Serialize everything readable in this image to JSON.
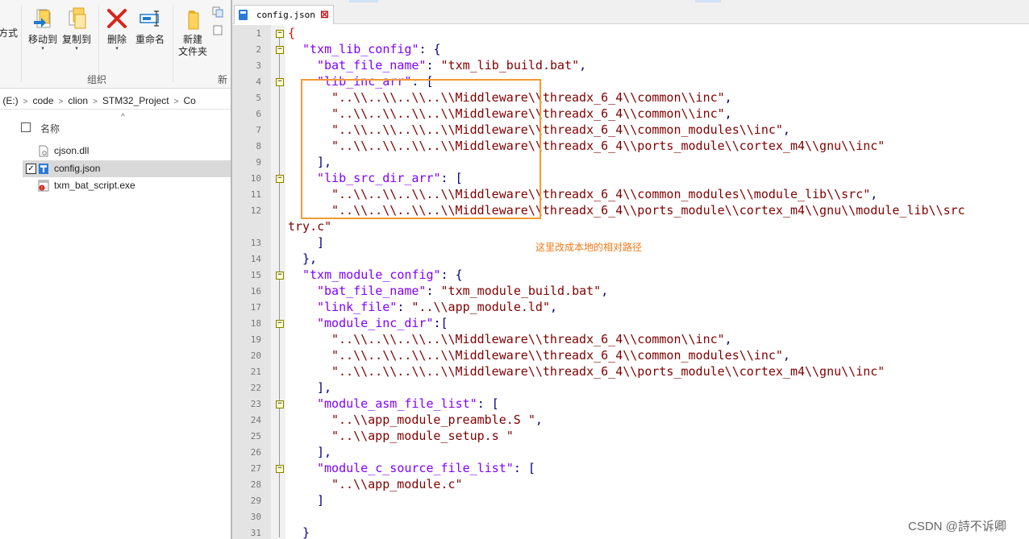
{
  "explorer": {
    "ribbon": {
      "cut_label": "方式",
      "move_to": "移动到",
      "copy_to": "复制到",
      "delete": "删除",
      "rename": "重命名",
      "new_folder_line1": "新建",
      "new_folder_line2": "文件夹",
      "group_organize": "组织",
      "group_new": "新",
      "icon_names": [
        "move-to-icon",
        "copy-to-icon",
        "delete-icon",
        "rename-icon",
        "new-folder-icon"
      ]
    },
    "breadcrumb": [
      "盘 (E:)",
      "code",
      "clion",
      "STM32_Project",
      "Co"
    ],
    "column_name": "名称",
    "files": [
      {
        "name": "cjson.dll",
        "icon": "dll-file-icon",
        "checked": false,
        "selected": false
      },
      {
        "name": "config.json",
        "icon": "json-file-icon",
        "checked": true,
        "selected": true
      },
      {
        "name": "txm_bat_script.exe",
        "icon": "exe-file-icon",
        "checked": false,
        "selected": false
      }
    ]
  },
  "editor": {
    "tab_label": "config.json",
    "tab_close": "⊠",
    "colors": {
      "keyword": "#8000ff",
      "string": "#800000",
      "punct": "#000080",
      "gutter": "#e4e4e4",
      "box": "#f39a36"
    },
    "line_numbers": [
      "1",
      "2",
      "3",
      "4",
      "5",
      "6",
      "7",
      "8",
      "9",
      "10",
      "11",
      "12",
      "13",
      "14",
      "15",
      "16",
      "17",
      "18",
      "19",
      "20",
      "21",
      "22",
      "23",
      "24",
      "25",
      "26",
      "27",
      "28",
      "29",
      "30",
      "31"
    ],
    "code": {
      "l1_open": "{",
      "l2_key": "\"txm_lib_config\"",
      "l2_rest": ": {",
      "l3_key": "\"bat_file_name\"",
      "l3_colon": ": ",
      "l3_val": "\"txm_lib_build.bat\"",
      "l3_end": ",",
      "l4_key": "\"lib_inc_arr\"",
      "l4_rest": ": [",
      "l5_val": "\"..\\\\..\\\\..\\\\..\\\\Middleware\\\\threadx_6_4\\\\common\\\\inc\"",
      "l6_val": "\"..\\\\..\\\\..\\\\..\\\\Middleware\\\\threadx_6_4\\\\common\\\\inc\"",
      "l7_val": "\"..\\\\..\\\\..\\\\..\\\\Middleware\\\\threadx_6_4\\\\common_modules\\\\inc\"",
      "l8_val": "\"..\\\\..\\\\..\\\\..\\\\Middleware\\\\threadx_6_4\\\\ports_module\\\\cortex_m4\\\\gnu\\\\inc\"",
      "l9": "],",
      "l10_key": "\"lib_src_dir_arr\"",
      "l10_rest": ": [",
      "l11_val": "\"..\\\\..\\\\..\\\\..\\\\Middleware\\\\threadx_6_4\\\\common_modules\\\\module_lib\\\\src\"",
      "l12_val": "\"..\\\\..\\\\..\\\\..\\\\Middleware\\\\threadx_6_4\\\\ports_module\\\\cortex_m4\\\\gnu\\\\module_lib\\\\src",
      "l12_wrap": "try.c\"",
      "l13": "]",
      "l14": "},",
      "l15_key": "\"txm_module_config\"",
      "l15_rest": ": {",
      "l16_key": "\"bat_file_name\"",
      "l16_val": "\"txm_module_build.bat\"",
      "l17_key": "\"link_file\"",
      "l17_val": "\"..\\\\app_module.ld\"",
      "l18_key": "\"module_inc_dir\"",
      "l18_rest": ":[",
      "l19_val": "\"..\\\\..\\\\..\\\\..\\\\Middleware\\\\threadx_6_4\\\\common\\\\inc\"",
      "l20_val": "\"..\\\\..\\\\..\\\\..\\\\Middleware\\\\threadx_6_4\\\\common_modules\\\\inc\"",
      "l21_val": "\"..\\\\..\\\\..\\\\..\\\\Middleware\\\\threadx_6_4\\\\ports_module\\\\cortex_m4\\\\gnu\\\\inc\"",
      "l22": "],",
      "l23_key": "\"module_asm_file_list\"",
      "l23_rest": ": [",
      "l24_val": "\"..\\\\app_module_preamble.S \"",
      "l25_val": "\"..\\\\app_module_setup.s \"",
      "l26": "],",
      "l27_key": "\"module_c_source_file_list\"",
      "l27_rest": ": [",
      "l28_val": "\"..\\\\app_module.c\"",
      "l29": "]",
      "l31": "}"
    },
    "comma": ",",
    "colon_space": ": ",
    "annotation": "这里改成本地的相对路径"
  },
  "watermark": "CSDN @詩不诉卿"
}
